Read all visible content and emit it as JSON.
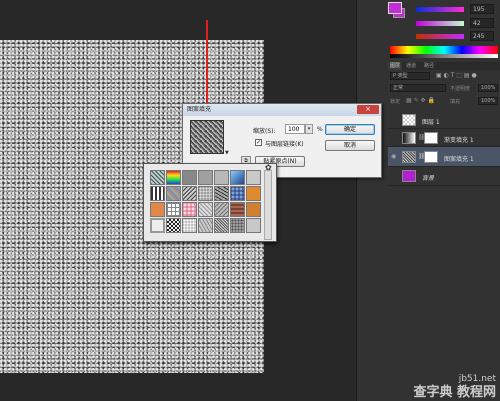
{
  "colors": {
    "foreground": "#c22ed6",
    "layer_fill": "#b21ed1",
    "selection_blue": "#4b5568",
    "arrow_red": "#e02020"
  },
  "color_panel": {
    "sliders": [
      {
        "channel": "R",
        "value": "195"
      },
      {
        "channel": "G",
        "value": "42"
      },
      {
        "channel": "B",
        "value": "245"
      }
    ]
  },
  "layers_panel": {
    "tabs": [
      "图层",
      "通道",
      "路径"
    ],
    "kind_filter": "P 类型",
    "blend_mode": "正常",
    "opacity_label": "不透明度",
    "opacity_value": "100%",
    "lock_label": "锁定",
    "fill_label": "填充",
    "fill_value": "100%",
    "layers": [
      {
        "name": "图层 1",
        "visible": false
      },
      {
        "name": "渐变填充 1",
        "visible": false
      },
      {
        "name": "图案填充 1",
        "visible": true,
        "selected": true
      },
      {
        "name": "背景",
        "visible": false
      }
    ]
  },
  "dialog": {
    "title": "图案填充",
    "close_icon": "close-icon",
    "scale_label": "缩放(S):",
    "scale_value": "100",
    "scale_unit": "%",
    "link_label": "与图层链接(K)",
    "link_checked": true,
    "snap_label": "贴紧原点(N)",
    "ok_label": "确定",
    "cancel_label": "取消"
  },
  "watermark": {
    "line1": "jb51.net",
    "line2": "查字典 教程网"
  }
}
